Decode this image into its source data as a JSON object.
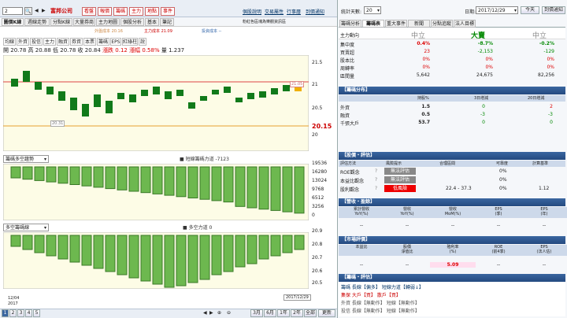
{
  "left_toolbar": {
    "code": "2",
    "company": "富邦公司",
    "red_buttons": [
      "看盤",
      "報價",
      "籌碼",
      "主力",
      "地點",
      "事件"
    ],
    "links": [
      "個股說明",
      "交易屬性",
      "行事曆",
      "到價通知"
    ]
  },
  "left_tabs": [
    "圖價K線",
    "週線走勢",
    "分點K線",
    "大量券商",
    "主力地圖",
    "個股分析",
    "基本",
    "筆記"
  ],
  "legend": {
    "outside_label": "外盤成本 20.16",
    "inner_label": "主力成本 21.09",
    "dash_label": "投資成本 --",
    "note": "粉紅色區塊為樂觀資訊區"
  },
  "sub_tabs": [
    "均線",
    "外資",
    "投信",
    "主力",
    "融資",
    "券資",
    "本票",
    "籌碼",
    "EPS",
    "紅綠柱",
    "說"
  ],
  "ohlc": {
    "open_label": "開",
    "open": "20.78",
    "high_label": "高",
    "high": "20.88",
    "low_label": "低",
    "low": "20.78",
    "close_label": "收",
    "close": "20.84",
    "chg_label": "漲跌",
    "chg": "0.12",
    "pct_label": "漲幅",
    "pct": "0.58%",
    "vol_label": "量",
    "vol": "1.237"
  },
  "price_axis": [
    "21.5",
    "21",
    "20.5",
    "20.15",
    "20"
  ],
  "price_tags": {
    "high": "21.05",
    "low": "20.31"
  },
  "panel2": {
    "select": "籌碼多空趨勢",
    "label": "■ 短線籌碼力道 -7123",
    "axis": [
      "19536",
      "16280",
      "13024",
      "9768",
      "6512",
      "3256",
      "0"
    ]
  },
  "panel3": {
    "select": "多空籌碼線",
    "label": "■ 多空力道 0",
    "axis": [
      "20.9",
      "20.8",
      "20.7",
      "20.6",
      "20.5"
    ]
  },
  "dates": {
    "start": "12/04",
    "year": "2017",
    "end": "2017/12/29"
  },
  "bottom_nav": {
    "pages": [
      "1",
      "2",
      "3",
      "4",
      "5"
    ],
    "ranges": [
      "3月",
      "6月",
      "1年",
      "2年",
      "全部"
    ],
    "update": "更新"
  },
  "right_top": {
    "days_label": "統計天數:",
    "days": "20",
    "date_label": "日期:",
    "date": "2017/12/29",
    "prev": "今天",
    "chip": "到價通知"
  },
  "right_tabs": [
    "籌碼分析",
    "籌碼表",
    "重大事件",
    "新聞",
    "分點追蹤",
    "法人目標"
  ],
  "main_force": {
    "title": "主力動向",
    "col1": "中立",
    "col2": "大賣",
    "col3": "中立",
    "rows": [
      {
        "label": "集中度",
        "v": [
          "0.4%",
          "-8.7%",
          "-0.2%"
        ],
        "colors": [
          "#d00",
          "#080",
          "#080"
        ]
      },
      {
        "label": "買賣超",
        "v": [
          "23",
          "-2,153",
          "-129"
        ],
        "colors": [
          "#d00",
          "#080",
          "#080"
        ]
      },
      {
        "label": "股本比",
        "v": [
          "0%",
          "0%",
          "0%"
        ],
        "colors": [
          "#d00",
          "#d00",
          "#d00"
        ]
      },
      {
        "label": "周轉率",
        "v": [
          "0%",
          "0%",
          "0%"
        ],
        "colors": [
          "#d00",
          "#d00",
          "#d00"
        ]
      },
      {
        "label": "區間量",
        "v": [
          "5,642",
          "24,675",
          "82,256"
        ],
        "colors": [
          "#222",
          "#222",
          "#222"
        ]
      }
    ]
  },
  "chip_dist": {
    "title": "【籌碼分布】",
    "headers": [
      "持股%",
      "3日增減",
      "20日增減"
    ],
    "rows": [
      {
        "label": "外資",
        "v": [
          "1.5",
          "0",
          "2"
        ],
        "colors": [
          "#222",
          "#080",
          "#d00"
        ]
      },
      {
        "label": "融資",
        "v": [
          "0.5",
          "-3",
          "-3"
        ],
        "colors": [
          "#222",
          "#080",
          "#080"
        ]
      },
      {
        "label": "千張大戶",
        "v": [
          "53.7",
          "0",
          "0"
        ],
        "colors": [
          "#222",
          "#080",
          "#080"
        ]
      }
    ]
  },
  "valuation": {
    "title": "【股價・評估】",
    "headers": [
      "評估方法",
      "風險提示",
      "合理區間",
      "可靠度",
      "計算基準"
    ],
    "rows": [
      {
        "label": "ROE觀念",
        "risk": "無法評估",
        "range": "",
        "rel": "0%",
        "base": ""
      },
      {
        "label": "本益比觀念",
        "risk": "無法評估",
        "range": "",
        "rel": "0%",
        "base": ""
      },
      {
        "label": "股利觀念",
        "risk": "低風險",
        "range": "22.4 - 37.3",
        "rel": "0%",
        "base": "1.12"
      }
    ]
  },
  "revenue": {
    "title": "【營收・盈餘】",
    "headers": [
      "累計營收\nYoY(%)",
      "營收\nYoY(%)",
      "營收\nMoM(%)",
      "EPS\n(季)",
      "EPS\n(年)"
    ],
    "values": [
      "--",
      "--",
      "--",
      "--",
      "--"
    ]
  },
  "market": {
    "title": "【市場評價】",
    "headers": [
      "本益比",
      "股價\n淨值比",
      "殖利率\n(%)",
      "ROE\n(前4季)",
      "EPS\n(法人估)"
    ],
    "values": [
      "--",
      "--",
      "5.09",
      "--",
      "--"
    ]
  },
  "signal": {
    "title": "【籌碼・評估】",
    "line1": "籌碼 長線【偏多】 短線力道【轉弱↓】",
    "line2": "集保 大戶【買】 散戶【買】",
    "line3": "外資 長線【無動作】 短線【無動作】",
    "line4": "投信 長線【無動作】 短線【無動作】"
  },
  "colors": {
    "up": "#d00",
    "down": "#080",
    "bar": "#3a8a2a",
    "navy": "#244a80"
  }
}
